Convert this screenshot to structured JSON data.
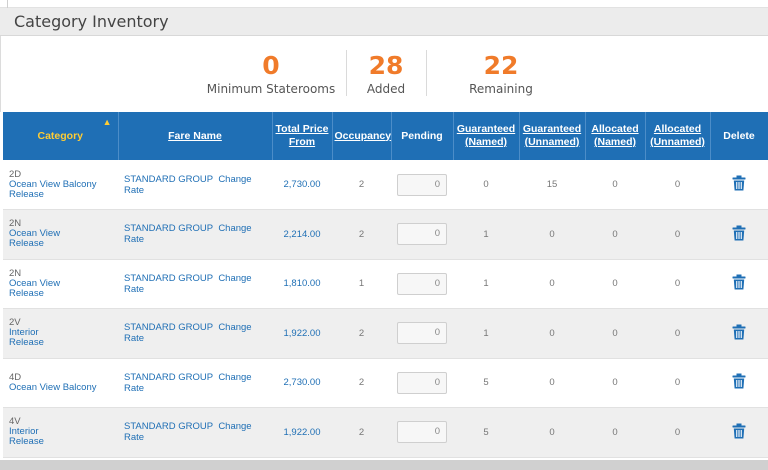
{
  "panel": {
    "title": "Category Inventory"
  },
  "stats": [
    {
      "value": "0",
      "label": "Minimum Staterooms"
    },
    {
      "value": "28",
      "label": "Added"
    },
    {
      "value": "22",
      "label": "Remaining"
    }
  ],
  "table": {
    "headers": {
      "category": "Category",
      "fare_name": "Fare Name",
      "total_price_line1": "Total Price",
      "total_price_line2": "From",
      "occupancy": "Occupancy",
      "pending": "Pending",
      "guaranteed_named_line1": "Guaranteed",
      "guaranteed_named_line2": "(Named)",
      "guaranteed_unnamed_line1": "Guaranteed",
      "guaranteed_unnamed_line2": "(Unnamed)",
      "allocated_named_line1": "Allocated",
      "allocated_named_line2": "(Named)",
      "allocated_unnamed_line1": "Allocated",
      "allocated_unnamed_line2": "(Unnamed)",
      "delete": "Delete"
    },
    "sort_icon": "sort-ascending-icon",
    "rows": [
      {
        "code": "2D",
        "name": "Ocean View Balcony",
        "release": "Release",
        "fare": "STANDARD GROUP",
        "change_rate": "Change Rate",
        "price": "2,730.00",
        "occupancy": "2",
        "pending": "0",
        "g_named": "0",
        "g_unnamed": "15",
        "a_named": "0",
        "a_unnamed": "0"
      },
      {
        "code": "2N",
        "name": "Ocean View",
        "release": "Release",
        "fare": "STANDARD GROUP",
        "change_rate": "Change Rate",
        "price": "2,214.00",
        "occupancy": "2",
        "pending": "0",
        "g_named": "1",
        "g_unnamed": "0",
        "a_named": "0",
        "a_unnamed": "0"
      },
      {
        "code": "2N",
        "name": "Ocean View",
        "release": "Release",
        "fare": "STANDARD GROUP",
        "change_rate": "Change Rate",
        "price": "1,810.00",
        "occupancy": "1",
        "pending": "0",
        "g_named": "1",
        "g_unnamed": "0",
        "a_named": "0",
        "a_unnamed": "0"
      },
      {
        "code": "2V",
        "name": "Interior",
        "release": "Release",
        "fare": "STANDARD GROUP",
        "change_rate": "Change Rate",
        "price": "1,922.00",
        "occupancy": "2",
        "pending": "0",
        "g_named": "1",
        "g_unnamed": "0",
        "a_named": "0",
        "a_unnamed": "0"
      },
      {
        "code": "4D",
        "name": "Ocean View Balcony",
        "release": "",
        "fare": "STANDARD GROUP",
        "change_rate": "Change Rate",
        "price": "2,730.00",
        "occupancy": "2",
        "pending": "0",
        "g_named": "5",
        "g_unnamed": "0",
        "a_named": "0",
        "a_unnamed": "0"
      },
      {
        "code": "4V",
        "name": "Interior",
        "release": "Release",
        "fare": "STANDARD GROUP",
        "change_rate": "Change Rate",
        "price": "1,922.00",
        "occupancy": "2",
        "pending": "0",
        "g_named": "5",
        "g_unnamed": "0",
        "a_named": "0",
        "a_unnamed": "0"
      }
    ],
    "delete_icon": "trash-icon"
  },
  "colors": {
    "header_blue": "#1f6fb5",
    "accent_orange": "#f07b2a",
    "sort_yellow": "#ffcc33"
  }
}
